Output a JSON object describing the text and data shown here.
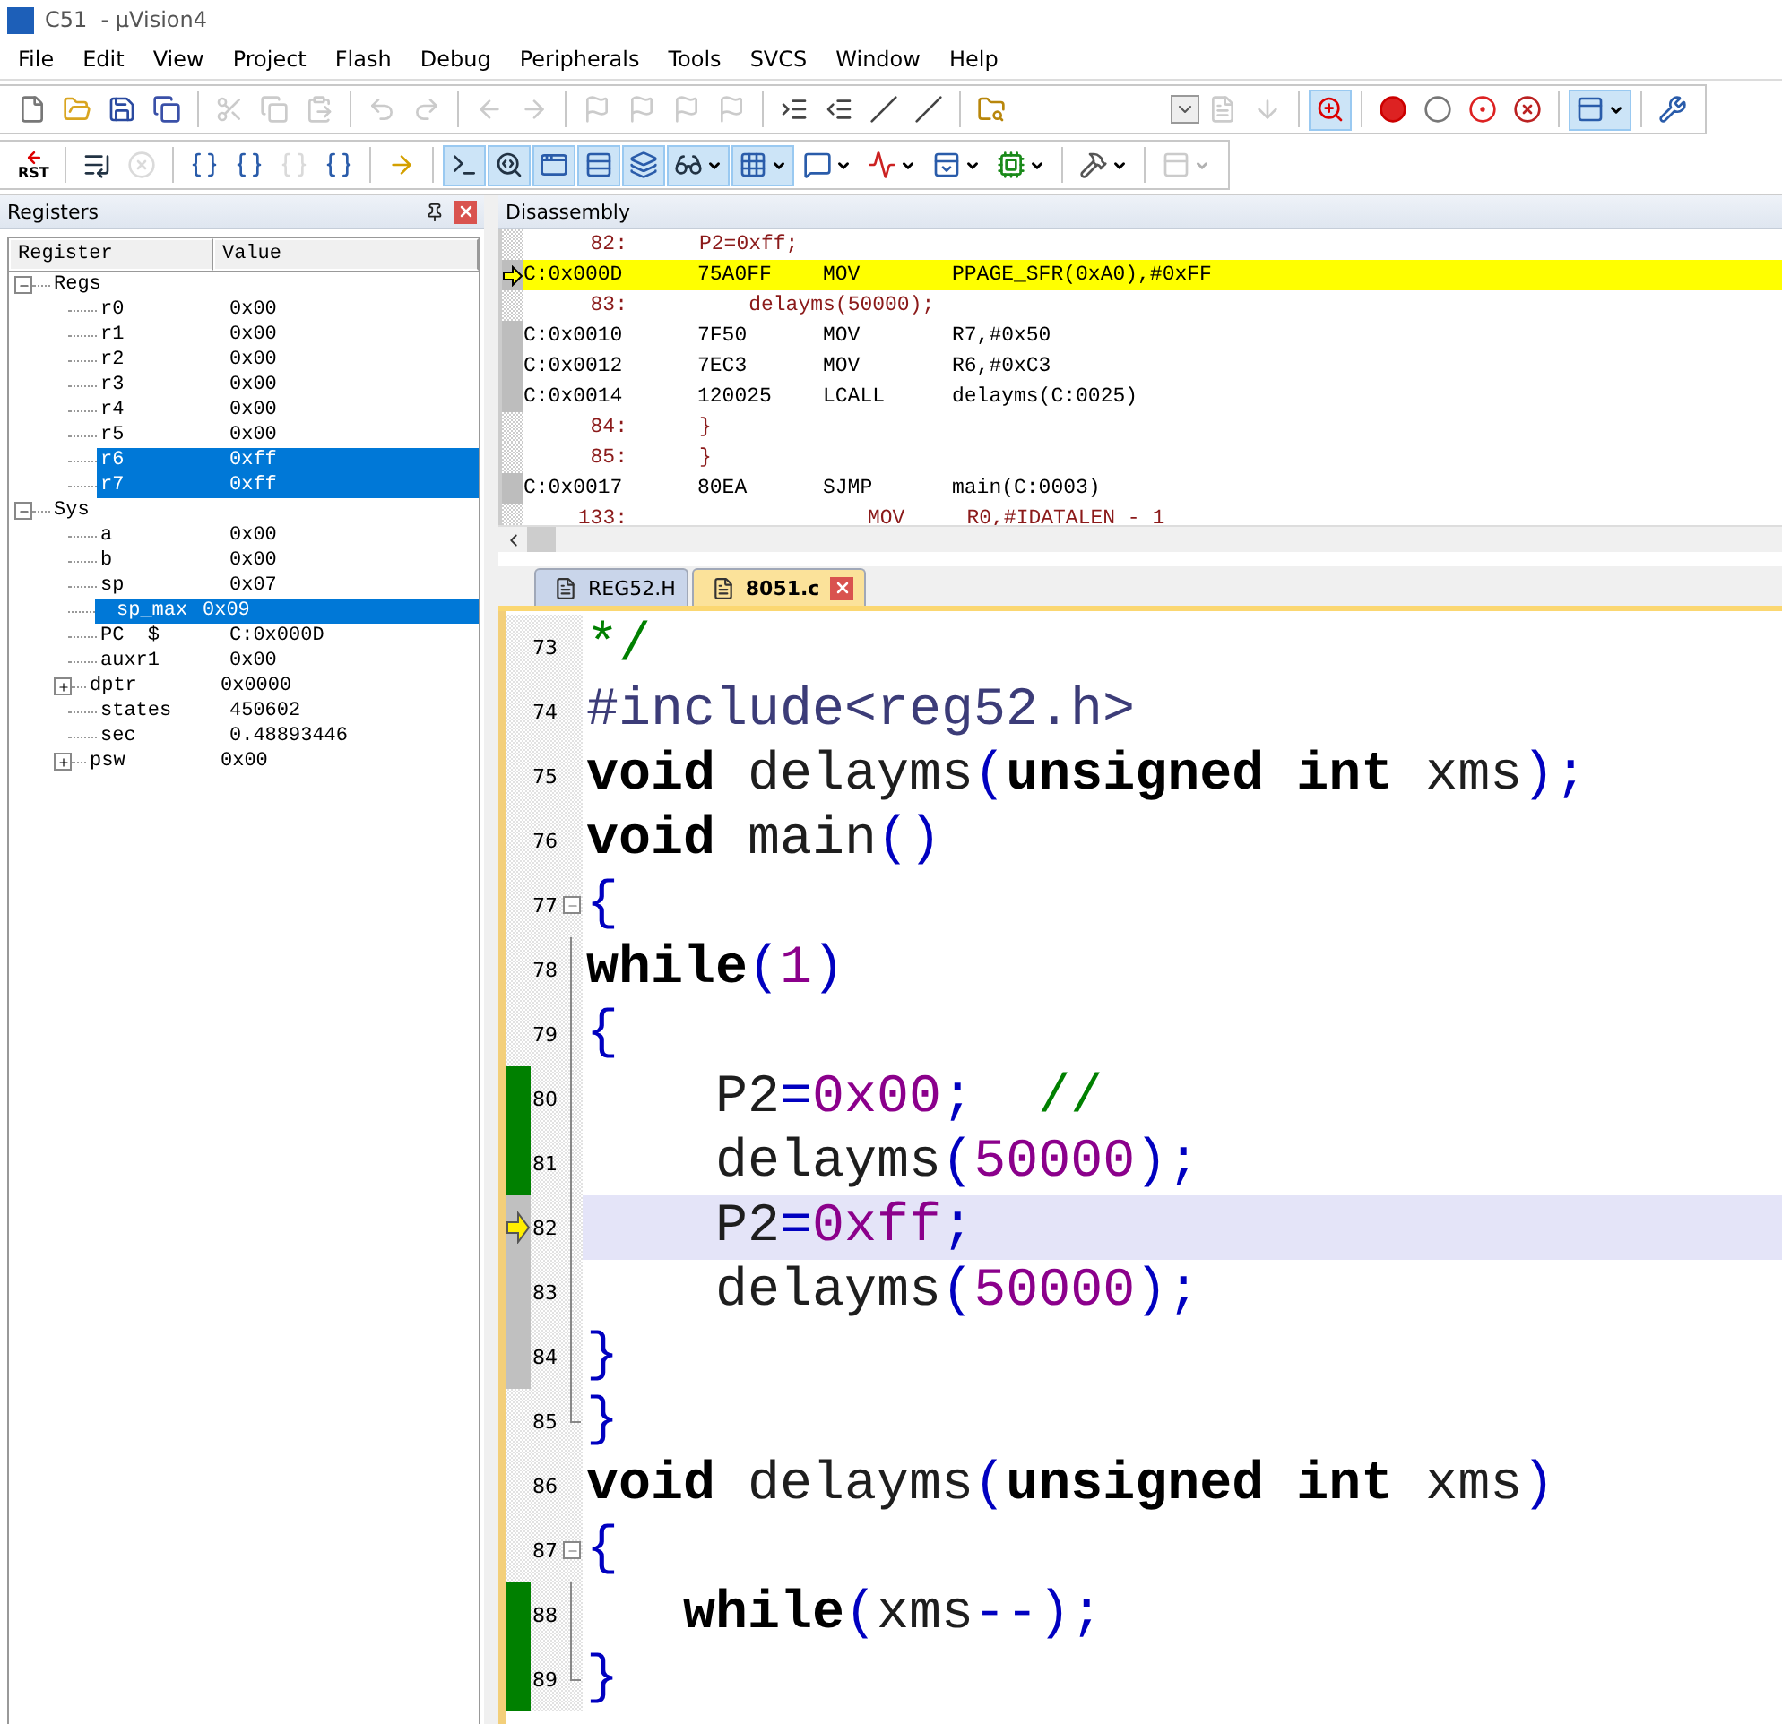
{
  "window": {
    "title": "C51  - µVision4"
  },
  "menu": [
    "File",
    "Edit",
    "View",
    "Project",
    "Flash",
    "Debug",
    "Peripherals",
    "Tools",
    "SVCS",
    "Window",
    "Help"
  ],
  "toolbar_1": [
    {
      "kind": "new",
      "disabled": false,
      "selected": false
    },
    {
      "kind": "open",
      "disabled": false,
      "selected": false
    },
    {
      "kind": "save",
      "disabled": false,
      "selected": false
    },
    {
      "kind": "save-all",
      "disabled": false,
      "selected": false
    },
    {
      "kind": "separator"
    },
    {
      "kind": "cut",
      "disabled": true,
      "selected": false
    },
    {
      "kind": "copy",
      "disabled": true,
      "selected": false
    },
    {
      "kind": "paste",
      "disabled": true,
      "selected": false
    },
    {
      "kind": "separator"
    },
    {
      "kind": "undo",
      "disabled": true,
      "selected": false
    },
    {
      "kind": "redo",
      "disabled": true,
      "selected": false
    },
    {
      "kind": "separator"
    },
    {
      "kind": "back",
      "disabled": true,
      "selected": false
    },
    {
      "kind": "forward",
      "disabled": true,
      "selected": false
    },
    {
      "kind": "separator"
    },
    {
      "kind": "bookmark",
      "disabled": true,
      "selected": false
    },
    {
      "kind": "bookmark",
      "disabled": true,
      "selected": false
    },
    {
      "kind": "bookmark",
      "disabled": true,
      "selected": false
    },
    {
      "kind": "bookmark",
      "disabled": true,
      "selected": false
    },
    {
      "kind": "separator"
    },
    {
      "kind": "indent",
      "disabled": false,
      "selected": false
    },
    {
      "kind": "outdent",
      "disabled": false,
      "selected": false
    },
    {
      "kind": "comment",
      "disabled": false,
      "selected": false
    },
    {
      "kind": "uncomment",
      "disabled": false,
      "selected": false
    },
    {
      "kind": "separator"
    },
    {
      "kind": "find-files",
      "disabled": false,
      "selected": false
    },
    {
      "kind": "spacer"
    },
    {
      "kind": "combo",
      "disabled": false,
      "selected": false
    },
    {
      "kind": "doc",
      "disabled": true,
      "selected": false
    },
    {
      "kind": "configure",
      "disabled": true,
      "selected": false
    },
    {
      "kind": "separator"
    },
    {
      "kind": "debug",
      "disabled": false,
      "selected": true
    },
    {
      "kind": "separator"
    },
    {
      "kind": "breakpoint",
      "disabled": false,
      "selected": false
    },
    {
      "kind": "breakpoint-off",
      "disabled": false,
      "selected": false
    },
    {
      "kind": "breakpoints",
      "disabled": false,
      "selected": false
    },
    {
      "kind": "kill-breakpoints",
      "disabled": false,
      "selected": false
    },
    {
      "kind": "separator"
    },
    {
      "kind": "window",
      "disabled": false,
      "selected": true,
      "dropdown": true
    },
    {
      "kind": "separator"
    },
    {
      "kind": "wrench",
      "disabled": false,
      "selected": false
    }
  ],
  "toolbar_2": [
    {
      "kind": "reset",
      "label": "RST",
      "disabled": false,
      "selected": false
    },
    {
      "kind": "separator"
    },
    {
      "kind": "run",
      "disabled": false,
      "selected": false
    },
    {
      "kind": "stop",
      "disabled": true,
      "selected": false
    },
    {
      "kind": "separator"
    },
    {
      "kind": "step-into",
      "disabled": false,
      "selected": false
    },
    {
      "kind": "step-over",
      "disabled": false,
      "selected": false
    },
    {
      "kind": "step-out",
      "disabled": true,
      "selected": false
    },
    {
      "kind": "run-to-cursor",
      "disabled": false,
      "selected": false
    },
    {
      "kind": "separator"
    },
    {
      "kind": "show-next",
      "disabled": false,
      "selected": false
    },
    {
      "kind": "separator"
    },
    {
      "kind": "command",
      "disabled": false,
      "selected": true
    },
    {
      "kind": "disassembly",
      "disabled": false,
      "selected": true
    },
    {
      "kind": "symbols",
      "disabled": false,
      "selected": true
    },
    {
      "kind": "registers",
      "disabled": false,
      "selected": true
    },
    {
      "kind": "call-stack",
      "disabled": false,
      "selected": true
    },
    {
      "kind": "watch",
      "disabled": false,
      "selected": true,
      "dropdown": true
    },
    {
      "kind": "memory",
      "disabled": false,
      "selected": true,
      "dropdown": true
    },
    {
      "kind": "serial",
      "disabled": false,
      "selected": false,
      "dropdown": true
    },
    {
      "kind": "analyzer",
      "disabled": false,
      "selected": false,
      "dropdown": true
    },
    {
      "kind": "viewer",
      "disabled": false,
      "selected": false,
      "dropdown": true
    },
    {
      "kind": "trace",
      "disabled": false,
      "selected": false,
      "dropdown": true
    },
    {
      "kind": "separator"
    },
    {
      "kind": "toolbox",
      "disabled": false,
      "selected": false,
      "dropdown": true
    },
    {
      "kind": "separator"
    },
    {
      "kind": "window",
      "disabled": true,
      "selected": false,
      "dropdown": true
    }
  ],
  "registers_panel": {
    "title": "Registers",
    "columns": [
      "Register",
      "Value"
    ],
    "groups": [
      {
        "name": "Regs",
        "expanded": true,
        "children": [
          {
            "name": "r0",
            "value": "0x00",
            "selected": false,
            "kind": "leaf"
          },
          {
            "name": "r1",
            "value": "0x00",
            "selected": false,
            "kind": "leaf"
          },
          {
            "name": "r2",
            "value": "0x00",
            "selected": false,
            "kind": "leaf"
          },
          {
            "name": "r3",
            "value": "0x00",
            "selected": false,
            "kind": "leaf"
          },
          {
            "name": "r4",
            "value": "0x00",
            "selected": false,
            "kind": "leaf"
          },
          {
            "name": "r5",
            "value": "0x00",
            "selected": false,
            "kind": "leaf"
          },
          {
            "name": "r6",
            "value": "0xff",
            "selected": true,
            "kind": "leaf"
          },
          {
            "name": "r7",
            "value": "0xff",
            "selected": true,
            "kind": "leaf"
          }
        ]
      },
      {
        "name": "Sys",
        "expanded": true,
        "children": [
          {
            "name": "a",
            "value": "0x00",
            "selected": false,
            "kind": "leaf"
          },
          {
            "name": "b",
            "value": "0x00",
            "selected": false,
            "kind": "leaf"
          },
          {
            "name": "sp",
            "value": "0x07",
            "selected": false,
            "kind": "leaf"
          },
          {
            "name": "sp_max",
            "value": "0x09",
            "selected": true,
            "kind": "sub"
          },
          {
            "name": "PC  $",
            "value": "C:0x000D",
            "selected": false,
            "kind": "leaf"
          },
          {
            "name": "auxr1",
            "value": "0x00",
            "selected": false,
            "kind": "leaf"
          },
          {
            "name": "dptr",
            "value": "0x0000",
            "selected": false,
            "kind": "collapsed"
          },
          {
            "name": "states",
            "value": "450602",
            "selected": false,
            "kind": "leaf"
          },
          {
            "name": "sec",
            "value": "0.48893446",
            "selected": false,
            "kind": "leaf"
          },
          {
            "name": "psw",
            "value": "0x00",
            "selected": false,
            "kind": "collapsed"
          }
        ]
      }
    ]
  },
  "disassembly": {
    "title": "Disassembly",
    "lines": [
      {
        "kind": "source",
        "line_no": "82:",
        "text": "P2=0xff;"
      },
      {
        "kind": "asm",
        "current": true,
        "address": "C:0x000D",
        "opcode": "75A0FF",
        "mnemonic": "MOV",
        "operands": "PPAGE_SFR(0xA0),#0xFF"
      },
      {
        "kind": "source",
        "line_no": "83:",
        "text": "    delayms(50000);"
      },
      {
        "kind": "asm",
        "current": false,
        "address": "C:0x0010",
        "opcode": "7F50",
        "mnemonic": "MOV",
        "operands": "R7,#0x50"
      },
      {
        "kind": "asm",
        "current": false,
        "address": "C:0x0012",
        "opcode": "7EC3",
        "mnemonic": "MOV",
        "operands": "R6,#0xC3"
      },
      {
        "kind": "asm",
        "current": false,
        "address": "C:0x0014",
        "opcode": "120025",
        "mnemonic": "LCALL",
        "operands": "delayms(C:0025)"
      },
      {
        "kind": "source",
        "line_no": "84:",
        "text": "}"
      },
      {
        "kind": "source",
        "line_no": "85:",
        "text": "}"
      },
      {
        "kind": "asm",
        "current": false,
        "address": "C:0x0017",
        "opcode": "80EA",
        "mnemonic": "SJMP",
        "operands": "main(C:0003)"
      },
      {
        "kind": "listing",
        "line_no": "133:",
        "text": "MOV     R0,#IDATALEN - 1"
      }
    ]
  },
  "editor": {
    "tabs": [
      {
        "label": "REG52.H",
        "selected": false
      },
      {
        "label": "8051.c",
        "selected": true
      }
    ],
    "lines": [
      {
        "number": "73",
        "current": false,
        "tokens": [
          {
            "kind": "comment",
            "text": "*/"
          }
        ]
      },
      {
        "number": "74",
        "current": false,
        "tokens": [
          {
            "kind": "preproc",
            "text": "#include<reg52.h>"
          }
        ]
      },
      {
        "number": "75",
        "current": false,
        "tokens": [
          {
            "kind": "keyword",
            "text": "void"
          },
          {
            "kind": "ident",
            "text": " delayms"
          },
          {
            "kind": "punct",
            "text": "("
          },
          {
            "kind": "keyword",
            "text": "unsigned int"
          },
          {
            "kind": "ident",
            "text": " xms"
          },
          {
            "kind": "punct",
            "text": ");"
          }
        ]
      },
      {
        "number": "76",
        "current": false,
        "tokens": [
          {
            "kind": "keyword",
            "text": "void"
          },
          {
            "kind": "ident",
            "text": " main"
          },
          {
            "kind": "punct",
            "text": "()"
          }
        ]
      },
      {
        "number": "77",
        "current": false,
        "fold_start": true,
        "tokens": [
          {
            "kind": "punct",
            "text": "{"
          }
        ]
      },
      {
        "number": "78",
        "current": false,
        "in_fold": true,
        "fold_end": false,
        "tokens": [
          {
            "kind": "keyword",
            "text": "while"
          },
          {
            "kind": "punct",
            "text": "("
          },
          {
            "kind": "number",
            "text": "1"
          },
          {
            "kind": "punct",
            "text": ")"
          }
        ]
      },
      {
        "number": "79",
        "current": false,
        "in_fold": true,
        "fold_end": false,
        "tokens": [
          {
            "kind": "punct",
            "text": "{"
          }
        ]
      },
      {
        "number": "80",
        "executed": true,
        "current": false,
        "in_fold": true,
        "fold_end": false,
        "tokens": [
          {
            "kind": "ident",
            "text": "    P2"
          },
          {
            "kind": "punct",
            "text": "="
          },
          {
            "kind": "number",
            "text": "0x00"
          },
          {
            "kind": "punct",
            "text": ";"
          },
          {
            "kind": "comment",
            "text": "  //"
          }
        ]
      },
      {
        "number": "81",
        "executed": true,
        "current": false,
        "in_fold": true,
        "fold_end": false,
        "tokens": [
          {
            "kind": "ident",
            "text": "    delayms"
          },
          {
            "kind": "punct",
            "text": "("
          },
          {
            "kind": "number",
            "text": "50000"
          },
          {
            "kind": "punct",
            "text": ");"
          }
        ]
      },
      {
        "number": "82",
        "executed": false,
        "current": true,
        "in_fold": true,
        "fold_end": false,
        "tokens": [
          {
            "kind": "ident",
            "text": "    P2"
          },
          {
            "kind": "punct",
            "text": "="
          },
          {
            "kind": "number",
            "text": "0xff"
          },
          {
            "kind": "punct",
            "text": ";"
          }
        ]
      },
      {
        "number": "83",
        "executed": false,
        "current": false,
        "in_fold": true,
        "fold_end": false,
        "tokens": [
          {
            "kind": "ident",
            "text": "    delayms"
          },
          {
            "kind": "punct",
            "text": "("
          },
          {
            "kind": "number",
            "text": "50000"
          },
          {
            "kind": "punct",
            "text": ");"
          }
        ]
      },
      {
        "number": "84",
        "executed": false,
        "current": false,
        "in_fold": true,
        "fold_end": false,
        "tokens": [
          {
            "kind": "punct",
            "text": "}"
          }
        ]
      },
      {
        "number": "85",
        "current": false,
        "in_fold": true,
        "fold_end": true,
        "tokens": [
          {
            "kind": "punct",
            "text": "}"
          }
        ]
      },
      {
        "number": "86",
        "current": false,
        "tokens": [
          {
            "kind": "keyword",
            "text": "void"
          },
          {
            "kind": "ident",
            "text": " delayms"
          },
          {
            "kind": "punct",
            "text": "("
          },
          {
            "kind": "keyword",
            "text": "unsigned int"
          },
          {
            "kind": "ident",
            "text": " xms"
          },
          {
            "kind": "punct",
            "text": ")"
          }
        ]
      },
      {
        "number": "87",
        "current": false,
        "fold_start": true,
        "tokens": [
          {
            "kind": "punct",
            "text": "{"
          }
        ]
      },
      {
        "number": "88",
        "executed": true,
        "current": false,
        "in_fold": true,
        "fold_end": false,
        "tokens": [
          {
            "kind": "keyword",
            "text": "   while"
          },
          {
            "kind": "punct",
            "text": "("
          },
          {
            "kind": "ident",
            "text": "xms"
          },
          {
            "kind": "punct",
            "text": "--);"
          }
        ]
      },
      {
        "number": "89",
        "executed": true,
        "current": false,
        "in_fold": true,
        "fold_end": true,
        "tokens": [
          {
            "kind": "punct",
            "text": "}"
          }
        ]
      }
    ]
  }
}
